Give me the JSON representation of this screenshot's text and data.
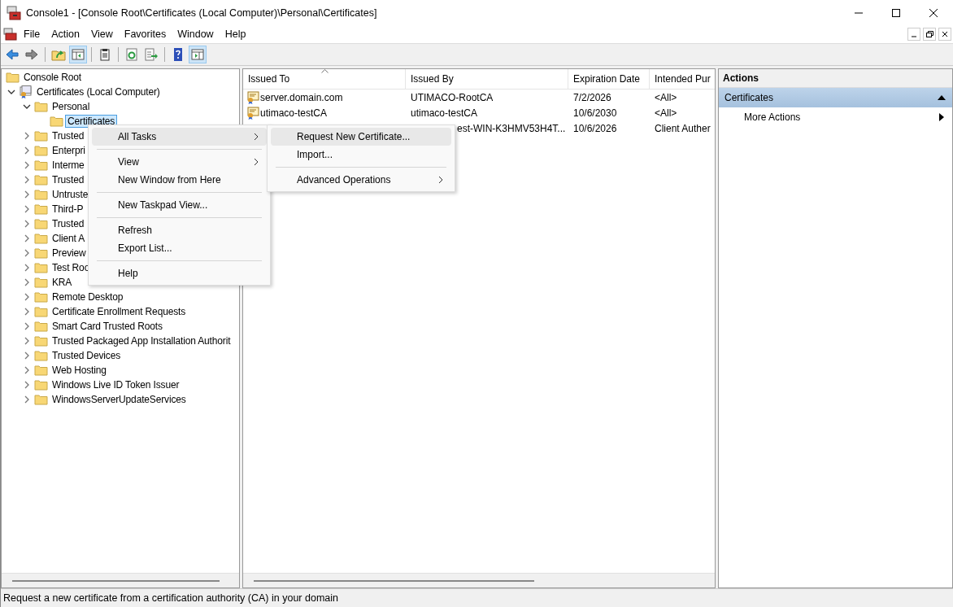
{
  "window": {
    "title": "Console1 - [Console Root\\Certificates (Local Computer)\\Personal\\Certificates]"
  },
  "menubar": [
    "File",
    "Action",
    "View",
    "Favorites",
    "Window",
    "Help"
  ],
  "toolbar": [
    {
      "kind": "back",
      "selected": false
    },
    {
      "kind": "forward",
      "selected": false
    },
    {
      "kind": "sep"
    },
    {
      "kind": "up",
      "selected": false
    },
    {
      "kind": "tree",
      "selected": true
    },
    {
      "kind": "sep"
    },
    {
      "kind": "clipboard",
      "selected": false
    },
    {
      "kind": "sep"
    },
    {
      "kind": "refresh",
      "selected": false
    },
    {
      "kind": "export",
      "selected": false
    },
    {
      "kind": "sep"
    },
    {
      "kind": "help",
      "selected": false
    },
    {
      "kind": "actionpane",
      "selected": true
    }
  ],
  "tree": [
    {
      "label": "Console Root",
      "kind": "folder",
      "selected": false,
      "children": [
        {
          "label": "Certificates (Local Computer)",
          "kind": "store",
          "selected": false,
          "expanded": true,
          "children": [
            {
              "label": "Personal",
              "kind": "folder",
              "selected": false,
              "expanded": true,
              "children": [
                {
                  "label": "Certificates",
                  "kind": "folder",
                  "selected": true
                }
              ]
            },
            {
              "label": "Trusted",
              "kind": "folder",
              "selected": false,
              "expanded": false
            },
            {
              "label": "Enterpri",
              "kind": "folder",
              "selected": false,
              "expanded": false
            },
            {
              "label": "Interme",
              "kind": "folder",
              "selected": false,
              "expanded": false
            },
            {
              "label": "Trusted",
              "kind": "folder",
              "selected": false,
              "expanded": false
            },
            {
              "label": "Untruste",
              "kind": "folder",
              "selected": false,
              "expanded": false
            },
            {
              "label": "Third-P",
              "kind": "folder",
              "selected": false,
              "expanded": false
            },
            {
              "label": "Trusted",
              "kind": "folder",
              "selected": false,
              "expanded": false
            },
            {
              "label": "Client A",
              "kind": "folder",
              "selected": false,
              "expanded": false
            },
            {
              "label": "Preview",
              "kind": "folder",
              "selected": false,
              "expanded": false
            },
            {
              "label": "Test Roo",
              "kind": "folder",
              "selected": false,
              "expanded": false
            },
            {
              "label": "KRA",
              "kind": "folder",
              "selected": false,
              "expanded": false
            },
            {
              "label": "Remote Desktop",
              "kind": "folder",
              "selected": false,
              "expanded": false
            },
            {
              "label": "Certificate Enrollment Requests",
              "kind": "folder",
              "selected": false,
              "expanded": false
            },
            {
              "label": "Smart Card Trusted Roots",
              "kind": "folder",
              "selected": false,
              "expanded": false
            },
            {
              "label": "Trusted Packaged App Installation Authorit",
              "kind": "folder",
              "selected": false,
              "expanded": false
            },
            {
              "label": "Trusted Devices",
              "kind": "folder",
              "selected": false,
              "expanded": false
            },
            {
              "label": "Web Hosting",
              "kind": "folder",
              "selected": false,
              "expanded": false
            },
            {
              "label": "Windows Live ID Token Issuer",
              "kind": "folder",
              "selected": false,
              "expanded": false
            },
            {
              "label": "WindowsServerUpdateServices",
              "kind": "folder",
              "selected": false,
              "expanded": false
            }
          ]
        }
      ]
    }
  ],
  "table": {
    "columns": [
      {
        "label": "Issued To",
        "sorted": true
      },
      {
        "label": "Issued By",
        "sorted": false
      },
      {
        "label": "Expiration Date",
        "sorted": false
      },
      {
        "label": "Intended Pur",
        "sorted": false
      }
    ],
    "rows": [
      {
        "issued_to": "server.domain.com",
        "issued_by": "UTIMACO-RootCA",
        "expiration": "7/2/2026",
        "purpose": "<All>"
      },
      {
        "issued_to": "utimaco-testCA",
        "issued_by": "utimaco-testCA",
        "expiration": "10/6/2030",
        "purpose": "<All>"
      },
      {
        "issued_by": "est-WIN-K3HMV53H4T...",
        "expiration": "10/6/2026",
        "purpose": "Client Auther"
      }
    ]
  },
  "actions": {
    "header": "Actions",
    "section": {
      "label": "Certificates",
      "expanded": true
    },
    "items": [
      "More Actions"
    ]
  },
  "context_menu": [
    {
      "kind": "item",
      "label": "All Tasks",
      "submenu": true,
      "selected": true
    },
    {
      "kind": "sep"
    },
    {
      "kind": "item",
      "label": "View",
      "submenu": true,
      "selected": false
    },
    {
      "kind": "item",
      "label": "New Window from Here",
      "submenu": false,
      "selected": false
    },
    {
      "kind": "sep"
    },
    {
      "kind": "item",
      "label": "New Taskpad View...",
      "submenu": false,
      "selected": false
    },
    {
      "kind": "sep"
    },
    {
      "kind": "item",
      "label": "Refresh",
      "submenu": false,
      "selected": false
    },
    {
      "kind": "item",
      "label": "Export List...",
      "submenu": false,
      "selected": false
    },
    {
      "kind": "sep"
    },
    {
      "kind": "item",
      "label": "Help",
      "submenu": false,
      "selected": false
    }
  ],
  "submenu": [
    {
      "kind": "item",
      "label": "Request New Certificate...",
      "submenu": false,
      "selected": true
    },
    {
      "kind": "item",
      "label": "Import...",
      "submenu": false,
      "selected": false
    },
    {
      "kind": "sep"
    },
    {
      "kind": "item",
      "label": "Advanced Operations",
      "submenu": true,
      "selected": false
    }
  ],
  "status_bar": "Request a new certificate from a certification authority (CA) in your domain"
}
